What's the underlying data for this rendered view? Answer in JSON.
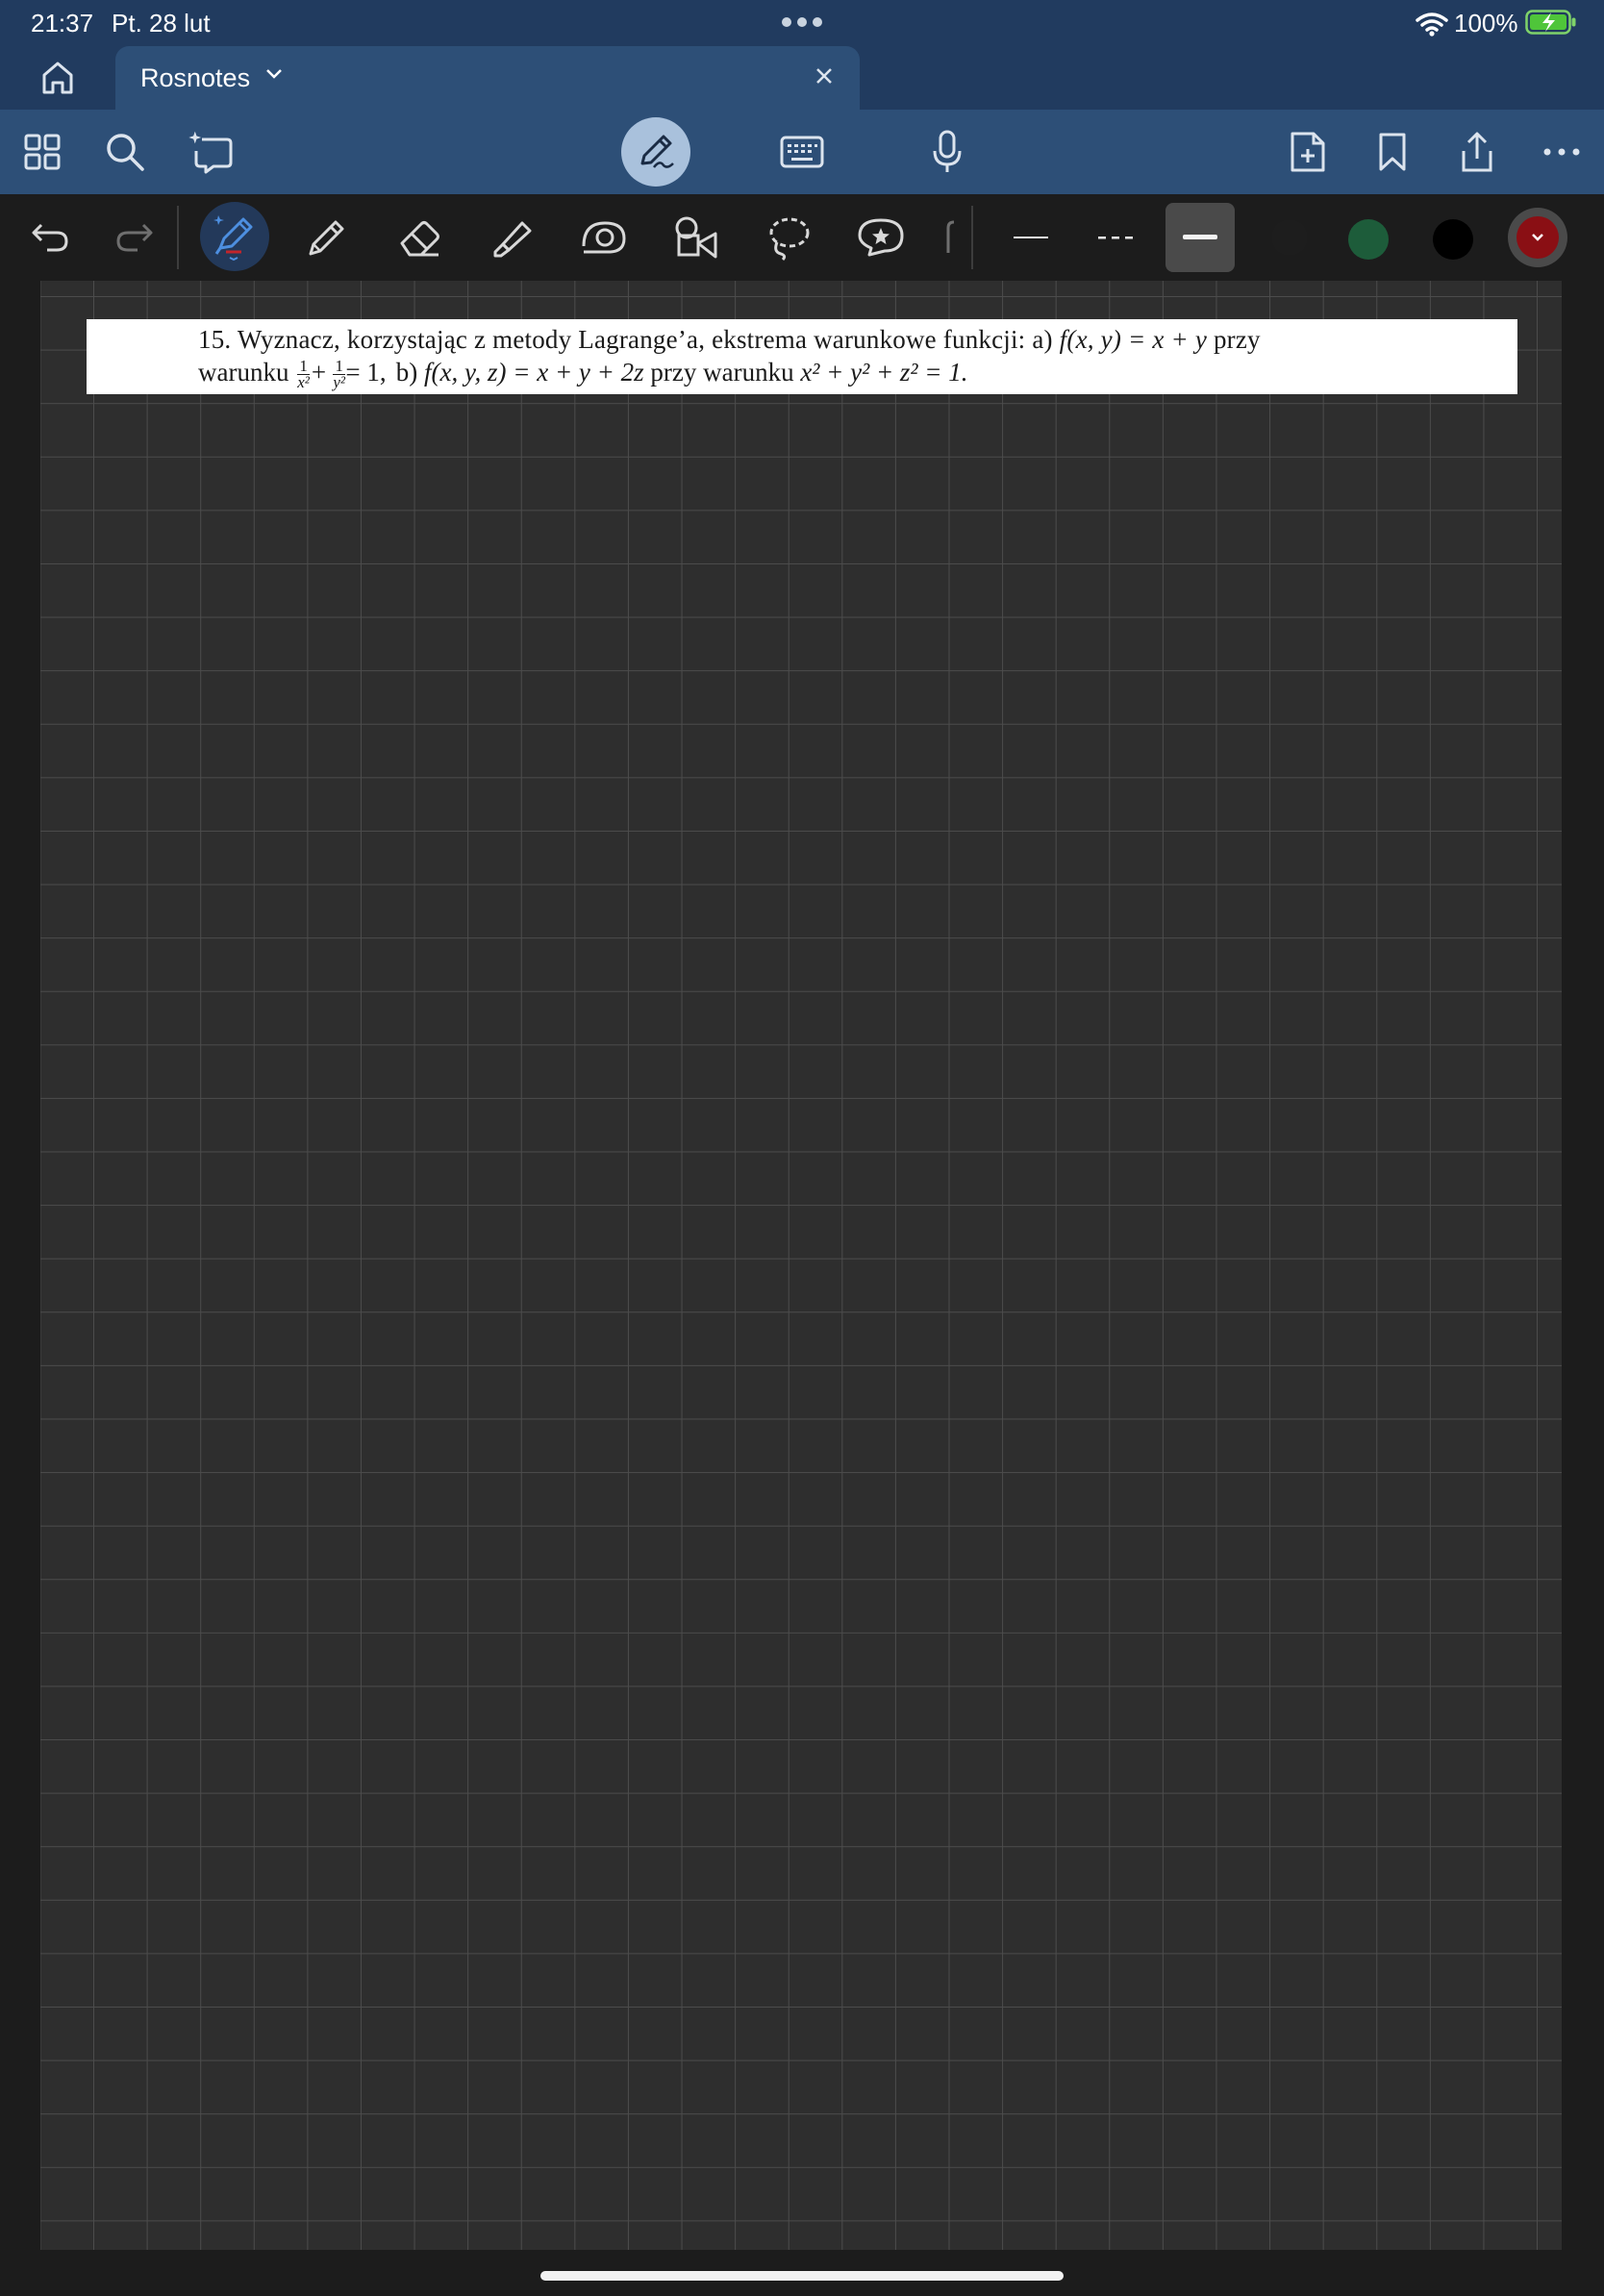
{
  "status_bar": {
    "time": "21:37",
    "date": "Pt. 28 lut",
    "battery": "100%"
  },
  "tabs": [
    {
      "label": "Rosnotes"
    }
  ],
  "toolbar_icons": {
    "left": [
      "grid-icon",
      "search-icon",
      "sparkle-lasso-icon"
    ],
    "center": [
      "pen-mode-icon",
      "keyboard-icon",
      "microphone-icon"
    ],
    "right": [
      "add-page-icon",
      "bookmark-icon",
      "share-icon",
      "more-icon"
    ]
  },
  "tools": [
    "undo-icon",
    "redo-icon",
    "fountain-pen-icon",
    "pencil-icon",
    "eraser-icon",
    "highlighter-icon",
    "shape-pen-icon",
    "shapes-icon",
    "lasso-icon",
    "sticker-icon"
  ],
  "colors": {
    "topbar": "#213b5f",
    "toolbar": "#2d4f77",
    "pen_active_bg": "#23395a",
    "swatch_green": "#1d5c3a",
    "swatch_black": "#000000",
    "swatch_red": "#8a0f14",
    "grid_background": "#2e2e2e",
    "grid_lines": "#4c4c4c"
  },
  "note": {
    "problem": {
      "number": "15.",
      "line1_text": "Wyznacz, korzystając z metody Lagrange’a, ekstrema warunkowe funkcji: a)",
      "line1_formula": "f(x, y) = x + y",
      "line1_tail": "przy",
      "line2_word": "warunku",
      "line2_cond_a": "+   = 1,",
      "line2_b": "b)",
      "line2_formula_b": "f(x, y, z) = x + y + 2z",
      "line2_mid": "przy warunku",
      "line2_cond_b": "x² + y² + z² = 1."
    }
  }
}
